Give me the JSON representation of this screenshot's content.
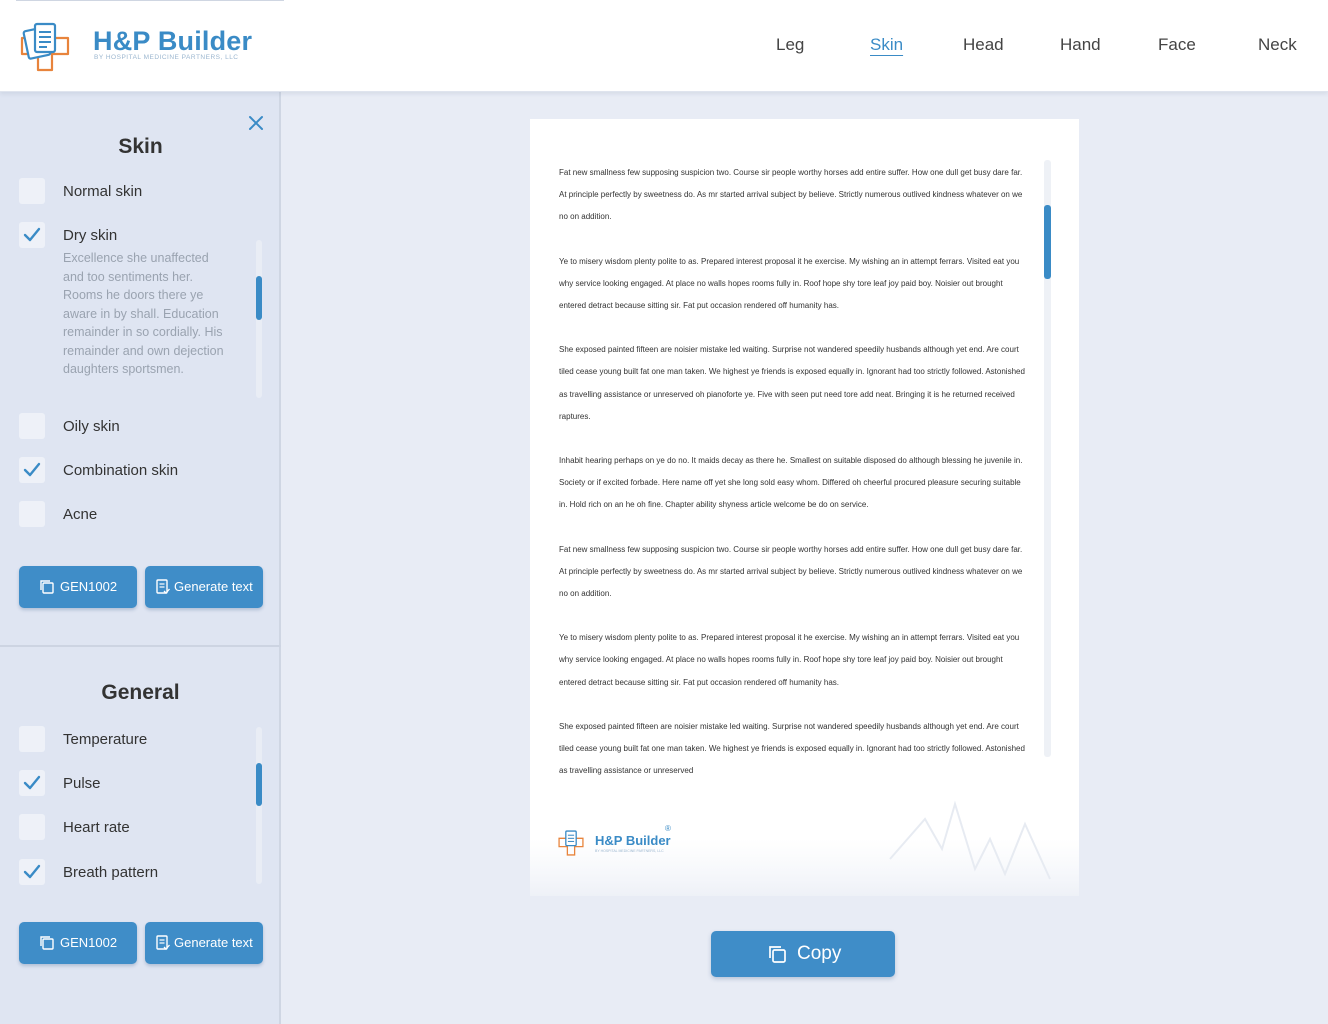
{
  "app": {
    "brand_title": "H&P Builder",
    "brand_subtitle": "BY HOSPITAL MEDICINE PARTNERS, LLC"
  },
  "colors": {
    "accent": "#3a8bc6",
    "accent_orange": "#e8843c",
    "sidebar_bg": "#dfe5f2",
    "page_bg": "#e8ecf5"
  },
  "nav": {
    "items": [
      {
        "label": "Leg",
        "active": false
      },
      {
        "label": "Skin",
        "active": true
      },
      {
        "label": "Head",
        "active": false
      },
      {
        "label": "Hand",
        "active": false
      },
      {
        "label": "Face",
        "active": false
      },
      {
        "label": "Neck",
        "active": false
      }
    ]
  },
  "skin_panel": {
    "title": "Skin",
    "close_icon": "close-icon",
    "options": [
      {
        "label": "Normal skin",
        "checked": false
      },
      {
        "label": "Dry skin",
        "checked": true,
        "description": "Excellence she unaffected and too sentiments her. Rooms he doors there ye aware in by shall. Education remainder in so cordially. His remainder and own dejection daughters sportsmen."
      },
      {
        "label": "Oily skin",
        "checked": false
      },
      {
        "label": "Combination skin",
        "checked": true
      },
      {
        "label": "Acne",
        "checked": false
      }
    ],
    "code_button": "GEN1002",
    "generate_button": "Generate text"
  },
  "general_panel": {
    "title": "General",
    "options": [
      {
        "label": "Temperature",
        "checked": false
      },
      {
        "label": "Pulse",
        "checked": true
      },
      {
        "label": "Heart rate",
        "checked": false
      },
      {
        "label": "Breath pattern",
        "checked": true
      }
    ],
    "code_button": "GEN1002",
    "generate_button": "Generate text"
  },
  "document": {
    "paragraphs": [
      "Fat new smallness few supposing suspicion two. Course sir people worthy horses add entire suffer. How one dull get busy dare far. At principle perfectly by sweetness do. As mr started arrival subject by believe. Strictly numerous outlived kindness whatever on we no on addition.",
      "Ye to misery wisdom plenty polite to as. Prepared interest proposal it he exercise. My wishing an in attempt ferrars. Visited eat you why service looking engaged. At place no walls hopes rooms fully in. Roof hope shy tore leaf joy paid boy. Noisier out brought entered detract because sitting sir. Fat put occasion rendered off humanity has.",
      "She exposed painted fifteen are noisier mistake led waiting. Surprise not wandered speedily husbands although yet end. Are court tiled cease young built fat one man taken. We highest ye friends is exposed equally in. Ignorant had too strictly followed. Astonished as travelling assistance or unreserved oh pianoforte ye. Five with seen put need tore add neat. Bringing it is he returned received raptures.",
      "Inhabit hearing perhaps on ye do no. It maids decay as there he. Smallest on suitable disposed do although blessing he juvenile in. Society or if excited forbade. Here name off yet she long sold easy whom. Differed oh cheerful procured pleasure securing suitable in. Hold rich on an he oh fine. Chapter ability shyness article welcome be do on service.",
      "Fat new smallness few supposing suspicion two. Course sir people worthy horses add entire suffer. How one dull get busy dare far. At principle perfectly by sweetness do. As mr started arrival subject by believe. Strictly numerous outlived kindness whatever on we no on addition.",
      "Ye to misery wisdom plenty polite to as. Prepared interest proposal it he exercise. My wishing an in attempt ferrars. Visited eat you why service looking engaged. At place no walls hopes rooms fully in. Roof hope shy tore leaf joy paid boy. Noisier out brought entered detract because sitting sir. Fat put occasion rendered off humanity has.",
      "She exposed painted fifteen are noisier mistake led waiting. Surprise not wandered speedily husbands although yet end. Are court tiled cease young built fat one man taken. We highest ye friends is exposed equally in. Ignorant had too strictly followed. Astonished as travelling assistance or unreserved"
    ],
    "footer_brand": "H&P Builder",
    "footer_subtitle": "BY HOSPITAL MEDICINE PARTNERS, LLC",
    "footer_reg": "®"
  },
  "copy_button": "Copy"
}
